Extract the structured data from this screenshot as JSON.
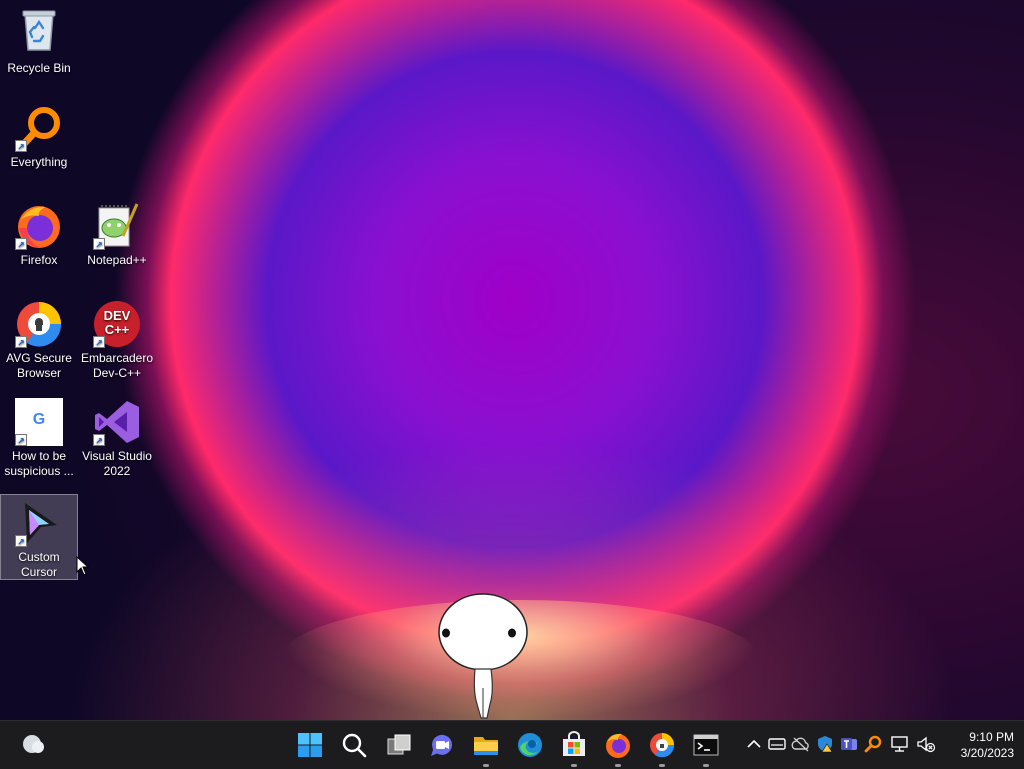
{
  "desktop": {
    "icons": [
      {
        "label": "Recycle Bin",
        "icon": "recycle-bin-icon"
      },
      {
        "label": "Everything",
        "icon": "everything-search-icon"
      },
      {
        "label": "Firefox",
        "icon": "firefox-icon"
      },
      {
        "label": "Notepad++",
        "icon": "notepad-plus-plus-icon"
      },
      {
        "label": "AVG Secure Browser",
        "icon": "avg-secure-browser-icon"
      },
      {
        "label": "Embarcadero Dev-C++",
        "icon": "dev-cpp-icon",
        "logo_text": "DEV C++"
      },
      {
        "label": "How to be suspicious ...",
        "icon": "google-shortcut-icon",
        "logo_text": "G"
      },
      {
        "label": "Visual Studio 2022",
        "icon": "visual-studio-icon"
      },
      {
        "label": "Custom Cursor",
        "icon": "custom-cursor-icon",
        "selected": true
      }
    ]
  },
  "taskbar": {
    "widgets": "weather-widget-icon",
    "apps": [
      {
        "name": "Start",
        "icon": "windows-start-icon",
        "running": false
      },
      {
        "name": "Search",
        "icon": "search-icon",
        "running": false
      },
      {
        "name": "Task View",
        "icon": "task-view-icon",
        "running": false
      },
      {
        "name": "Chat",
        "icon": "teams-chat-icon",
        "running": false
      },
      {
        "name": "File Explorer",
        "icon": "file-explorer-icon",
        "running": true
      },
      {
        "name": "Microsoft Edge",
        "icon": "edge-icon",
        "running": false
      },
      {
        "name": "Microsoft Store",
        "icon": "store-icon",
        "running": true
      },
      {
        "name": "Firefox",
        "icon": "firefox-icon",
        "running": true
      },
      {
        "name": "AVG Secure Browser",
        "icon": "avg-secure-browser-icon",
        "running": true
      },
      {
        "name": "Terminal",
        "icon": "terminal-icon",
        "running": true
      }
    ],
    "tray": [
      "chevron-up-icon",
      "drive-icon",
      "onedrive-icon",
      "security-warning-icon",
      "teams-icon",
      "everything-tray-icon",
      "network-icon",
      "volume-muted-icon"
    ],
    "clock": {
      "time": "9:10 PM",
      "date": "3/20/2023"
    }
  },
  "colors": {
    "taskbar_bg": "#1c1c1e",
    "accent": "#0078d4",
    "selection": "#ffffff38"
  }
}
